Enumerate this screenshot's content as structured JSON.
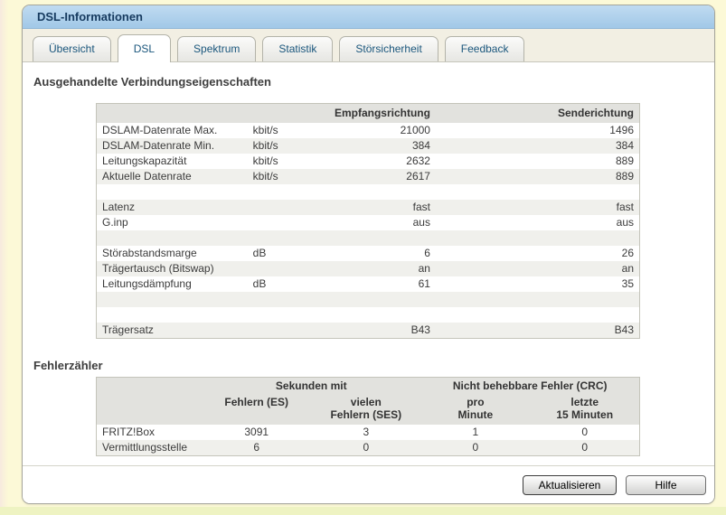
{
  "window": {
    "title": "DSL-Informationen"
  },
  "tabs": [
    {
      "label": "Übersicht",
      "active": false
    },
    {
      "label": "DSL",
      "active": true
    },
    {
      "label": "Spektrum",
      "active": false
    },
    {
      "label": "Statistik",
      "active": false
    },
    {
      "label": "Störsicherheit",
      "active": false
    },
    {
      "label": "Feedback",
      "active": false
    }
  ],
  "sections": {
    "connection": {
      "heading": "Ausgehandelte Verbindungseigenschaften",
      "table": {
        "headers": [
          "",
          "",
          "Empfangsrichtung",
          "Senderichtung"
        ],
        "rows": [
          [
            "DSLAM-Datenrate Max.",
            "kbit/s",
            "21000",
            "1496"
          ],
          [
            "DSLAM-Datenrate Min.",
            "kbit/s",
            "384",
            "384"
          ],
          [
            "Leitungskapazität",
            "kbit/s",
            "2632",
            "889"
          ],
          [
            "Aktuelle Datenrate",
            "kbit/s",
            "2617",
            "889"
          ],
          [
            "",
            "",
            "",
            ""
          ],
          [
            "Latenz",
            "",
            "fast",
            "fast"
          ],
          [
            "G.inp",
            "",
            "aus",
            "aus"
          ],
          [
            "",
            "",
            "",
            ""
          ],
          [
            "Störabstandsmarge",
            "dB",
            "6",
            "26"
          ],
          [
            "Trägertausch (Bitswap)",
            "",
            "an",
            "an"
          ],
          [
            "Leitungsdämpfung",
            "dB",
            "61",
            "35"
          ],
          [
            "",
            "",
            "",
            ""
          ],
          [
            "",
            "",
            "",
            ""
          ],
          [
            "Trägersatz",
            "",
            "B43",
            "B43"
          ]
        ]
      }
    },
    "errors": {
      "heading": "Fehlerzähler",
      "table": {
        "group_headers": [
          "Sekunden mit",
          "Nicht behebbare Fehler (CRC)"
        ],
        "col_headers": [
          [
            "Fehlern (ES)",
            ""
          ],
          [
            "vielen",
            "Fehlern (SES)"
          ],
          [
            "pro",
            "Minute"
          ],
          [
            "letzte",
            "15 Minuten"
          ]
        ],
        "rows": [
          [
            "FRITZ!Box",
            "3091",
            "3",
            "1",
            "0"
          ],
          [
            "Vermittlungsstelle",
            "6",
            "0",
            "0",
            "0"
          ]
        ]
      }
    }
  },
  "footer": {
    "buttons": [
      {
        "label": "Aktualisieren"
      },
      {
        "label": "Hilfe"
      }
    ]
  },
  "colors": {
    "titlebar_blue": "#a9cbe9",
    "titlebar_text": "#163a5f",
    "tab_text": "#1a567c",
    "tabstrip_bg": "#f2efe3",
    "page_bg": "#fcf9d7",
    "page_bottom_strip": "#eef3c2",
    "table_header_gray": "#e2e2de",
    "table_stripe_gray": "#f0f0ec",
    "panel_border": "#a5a59b"
  }
}
